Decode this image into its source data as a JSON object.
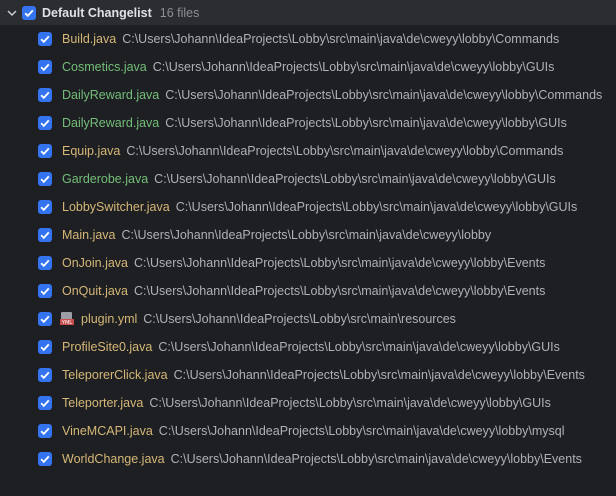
{
  "changelist": {
    "title": "Default Changelist",
    "count": "16 files",
    "files": [
      {
        "name": "Build.java",
        "path": "C:\\Users\\Johann\\IdeaProjects\\Lobby\\src\\main\\java\\de\\cweyy\\lobby\\Commands",
        "status": "modified",
        "icon": "java-file-icon"
      },
      {
        "name": "Cosmetics.java",
        "path": "C:\\Users\\Johann\\IdeaProjects\\Lobby\\src\\main\\java\\de\\cweyy\\lobby\\GUIs",
        "status": "added",
        "icon": "java-file-icon"
      },
      {
        "name": "DailyReward.java",
        "path": "C:\\Users\\Johann\\IdeaProjects\\Lobby\\src\\main\\java\\de\\cweyy\\lobby\\Commands",
        "status": "added",
        "icon": "java-file-icon"
      },
      {
        "name": "DailyReward.java",
        "path": "C:\\Users\\Johann\\IdeaProjects\\Lobby\\src\\main\\java\\de\\cweyy\\lobby\\GUIs",
        "status": "added",
        "icon": "java-file-icon"
      },
      {
        "name": "Equip.java",
        "path": "C:\\Users\\Johann\\IdeaProjects\\Lobby\\src\\main\\java\\de\\cweyy\\lobby\\Commands",
        "status": "modified",
        "icon": "java-file-icon"
      },
      {
        "name": "Garderobe.java",
        "path": "C:\\Users\\Johann\\IdeaProjects\\Lobby\\src\\main\\java\\de\\cweyy\\lobby\\GUIs",
        "status": "added",
        "icon": "java-file-icon"
      },
      {
        "name": "LobbySwitcher.java",
        "path": "C:\\Users\\Johann\\IdeaProjects\\Lobby\\src\\main\\java\\de\\cweyy\\lobby\\GUIs",
        "status": "modified",
        "icon": "java-file-icon"
      },
      {
        "name": "Main.java",
        "path": "C:\\Users\\Johann\\IdeaProjects\\Lobby\\src\\main\\java\\de\\cweyy\\lobby",
        "status": "modified",
        "icon": "java-file-icon"
      },
      {
        "name": "OnJoin.java",
        "path": "C:\\Users\\Johann\\IdeaProjects\\Lobby\\src\\main\\java\\de\\cweyy\\lobby\\Events",
        "status": "modified",
        "icon": "java-file-icon"
      },
      {
        "name": "OnQuit.java",
        "path": "C:\\Users\\Johann\\IdeaProjects\\Lobby\\src\\main\\java\\de\\cweyy\\lobby\\Events",
        "status": "modified",
        "icon": "java-file-icon"
      },
      {
        "name": "plugin.yml",
        "path": "C:\\Users\\Johann\\IdeaProjects\\Lobby\\src\\main\\resources",
        "status": "modified",
        "icon": "yml-file-icon"
      },
      {
        "name": "ProfileSite0.java",
        "path": "C:\\Users\\Johann\\IdeaProjects\\Lobby\\src\\main\\java\\de\\cweyy\\lobby\\GUIs",
        "status": "modified",
        "icon": "java-file-icon"
      },
      {
        "name": "TeleporerClick.java",
        "path": "C:\\Users\\Johann\\IdeaProjects\\Lobby\\src\\main\\java\\de\\cweyy\\lobby\\Events",
        "status": "modified",
        "icon": "java-file-icon"
      },
      {
        "name": "Teleporter.java",
        "path": "C:\\Users\\Johann\\IdeaProjects\\Lobby\\src\\main\\java\\de\\cweyy\\lobby\\GUIs",
        "status": "modified",
        "icon": "java-file-icon"
      },
      {
        "name": "VineMCAPI.java",
        "path": "C:\\Users\\Johann\\IdeaProjects\\Lobby\\src\\main\\java\\de\\cweyy\\lobby\\mysql",
        "status": "modified",
        "icon": "java-file-icon"
      },
      {
        "name": "WorldChange.java",
        "path": "C:\\Users\\Johann\\IdeaProjects\\Lobby\\src\\main\\java\\de\\cweyy\\lobby\\Events",
        "status": "modified",
        "icon": "java-file-icon"
      }
    ]
  },
  "colors": {
    "background": "#1e1f22",
    "header_background": "#2b2d30",
    "checkbox": "#3574f0",
    "modified_text": "#d5b778",
    "added_text": "#73bd79",
    "path_text": "#aeb1b7"
  }
}
